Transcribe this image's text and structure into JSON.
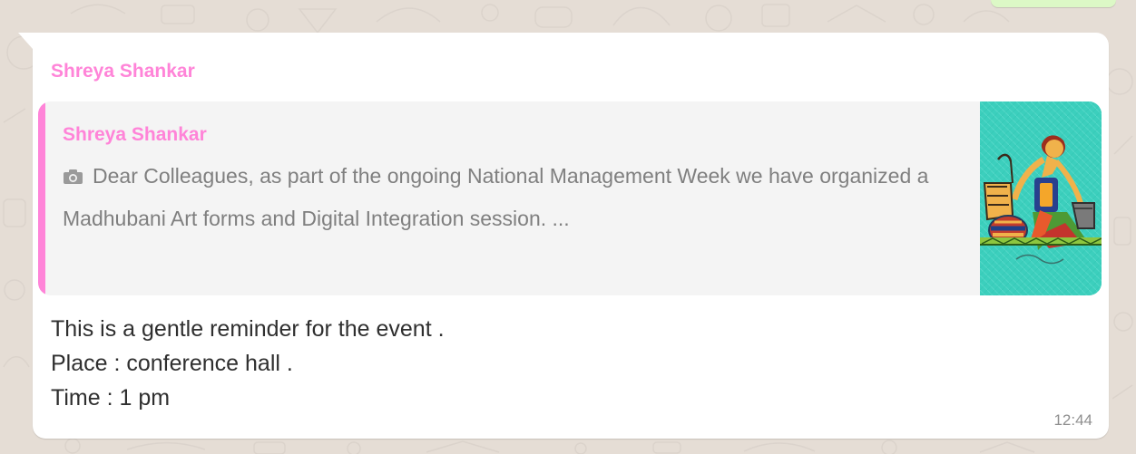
{
  "chat": {
    "message": {
      "sender": "Shreya Shankar",
      "quote": {
        "author": "Shreya Shankar",
        "media_icon": "camera-icon",
        "text": "Dear Colleagues, as part of the ongoing National Management Week we have organized a Madhubani Art forms and Digital Integration session. ..."
      },
      "lines": [
        "This is a gentle reminder for the event .",
        "Place : conference hall .",
        "Time : 1 pm"
      ],
      "time": "12:44"
    }
  },
  "colors": {
    "background": "#e5ddd5",
    "bubble": "#ffffff",
    "accent": "#ff84d8",
    "quote_bg": "#f4f4f4",
    "thumbnail": "#3ccfbd",
    "outgoing_bubble": "#dcf8c6"
  }
}
